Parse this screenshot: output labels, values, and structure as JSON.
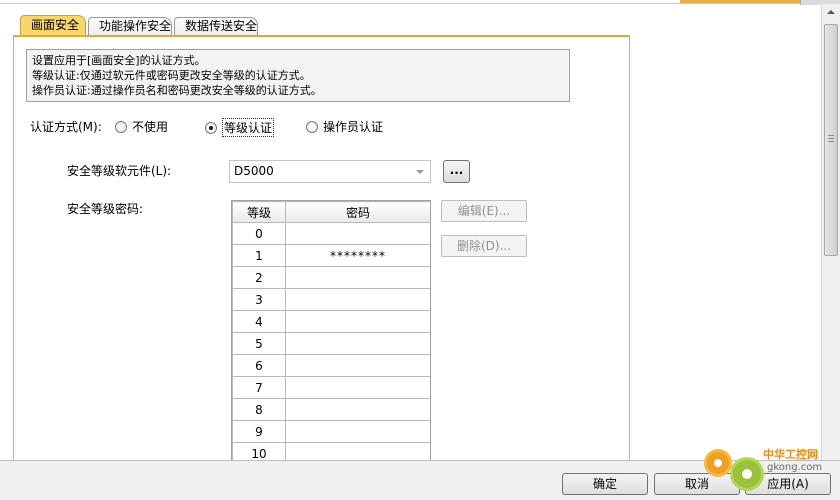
{
  "tabs": [
    {
      "label": "画面安全",
      "active": true
    },
    {
      "label": "功能操作安全",
      "active": false
    },
    {
      "label": "数据传送安全",
      "active": false
    }
  ],
  "info": {
    "lines": [
      "设置应用于[画面安全]的认证方式。",
      "等级认证:仅通过软元件或密码更改安全等级的认证方式。",
      "操作员认证:通过操作员名和密码更改安全等级的认证方式。"
    ]
  },
  "auth": {
    "label": "认证方式(M):",
    "options": [
      {
        "label": "不使用",
        "checked": false
      },
      {
        "label": "等级认证",
        "checked": true
      },
      {
        "label": "操作员认证",
        "checked": false
      }
    ]
  },
  "device": {
    "label": "安全等级软元件(L):",
    "value": "D5000",
    "browse_label": "..."
  },
  "password": {
    "label": "安全等级密码:",
    "columns": [
      "等级",
      "密码"
    ],
    "rows": [
      {
        "level": "0",
        "password": ""
      },
      {
        "level": "1",
        "password": "********"
      },
      {
        "level": "2",
        "password": ""
      },
      {
        "level": "3",
        "password": ""
      },
      {
        "level": "4",
        "password": ""
      },
      {
        "level": "5",
        "password": ""
      },
      {
        "level": "6",
        "password": ""
      },
      {
        "level": "7",
        "password": ""
      },
      {
        "level": "8",
        "password": ""
      },
      {
        "level": "9",
        "password": ""
      },
      {
        "level": "10",
        "password": ""
      }
    ],
    "edit_label": "编辑(E)...",
    "delete_label": "删除(D)..."
  },
  "buttons": {
    "ok": "确定",
    "cancel": "取消",
    "apply": "应用(A)"
  },
  "watermark": {
    "name": "中华工控网",
    "url": "gkong.com"
  },
  "icons": {
    "browse": "ellipsis-icon",
    "combo_arrow": "chevron-down-icon",
    "scroll_up": "chevron-up-icon",
    "watermark": "gear-icon"
  },
  "colors": {
    "active_tab": "#fbd56a",
    "panel_accent": "#e3a82c",
    "info_bg": "#f3f3f3",
    "disabled_text": "#8f8f8f"
  }
}
